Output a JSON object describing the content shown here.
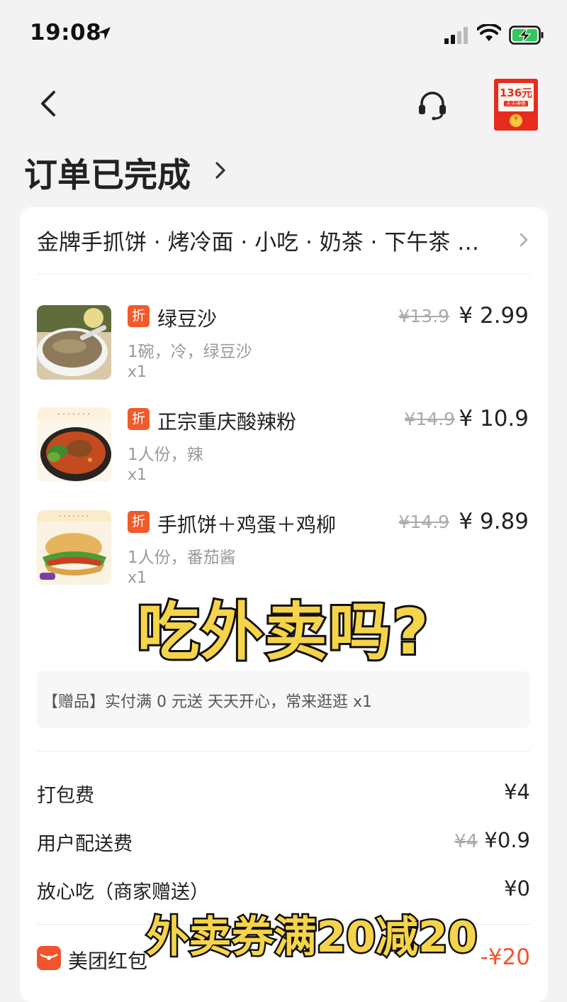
{
  "status_bar": {
    "time": "19:08",
    "icons": [
      "location-arrow-icon",
      "cellular-signal-icon",
      "wifi-icon",
      "battery-charging-icon"
    ]
  },
  "nav": {
    "back_icon": "chevron-left-icon",
    "service_icon": "headset-icon",
    "red_packet": {
      "amount": "136元",
      "sub": "天天神券",
      "coin": "¥"
    }
  },
  "order": {
    "status_title": "订单已完成",
    "store_name": "金牌手抓饼 · 烤冷面 · 小吃 · 奶茶 · 下午茶 …",
    "items": [
      {
        "badge": "折",
        "name": "绿豆沙",
        "spec": "1碗，冷，绿豆沙",
        "qty": "x1",
        "original_price": "¥13.9",
        "price": "¥ 2.99"
      },
      {
        "badge": "折",
        "name": "正宗重庆酸辣粉",
        "spec": "1人份，辣",
        "qty": "x1",
        "original_price": "¥14.9",
        "price": "¥ 10.9"
      },
      {
        "badge": "折",
        "name": "手抓饼＋鸡蛋＋鸡柳",
        "spec": "1人份，番茄酱",
        "qty": "x1",
        "original_price": "¥14.9",
        "price": "¥ 9.89"
      }
    ],
    "gift": "【赠品】实付满 0 元送 天天开心，常来逛逛 x1",
    "fees": [
      {
        "label": "打包费",
        "original": "",
        "value": "¥4"
      },
      {
        "label": "用户配送费",
        "original": "¥4",
        "value": "¥0.9"
      },
      {
        "label": "放心吃（商家赠送）",
        "original": "",
        "value": "¥0"
      }
    ],
    "coupon": {
      "label": "美团红包",
      "value": "-¥20"
    }
  },
  "overlay": {
    "caption_top": "吃外卖吗?",
    "caption_bottom": "外卖券满20减20"
  },
  "colors": {
    "accent_orange": "#f15a2b",
    "caption_yellow": "#f6d44a",
    "background": "#f3f3f3",
    "red_packet": "#e62c1f"
  }
}
